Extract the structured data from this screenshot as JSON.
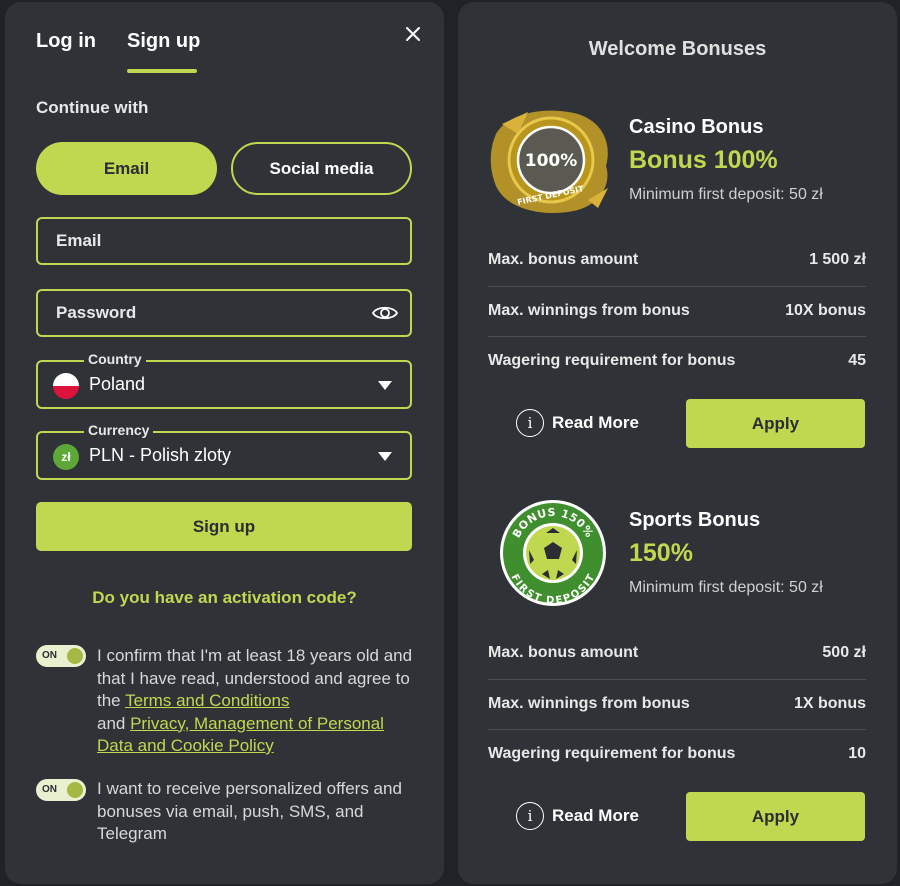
{
  "auth": {
    "tabs": [
      {
        "label": "Log in"
      },
      {
        "label": "Sign up"
      }
    ],
    "continue_with": "Continue with",
    "methods": {
      "email": "Email",
      "social": "Social media"
    },
    "email_placeholder": "Email",
    "password_placeholder": "Password",
    "country": {
      "label": "Country",
      "value": "Poland"
    },
    "currency": {
      "label": "Currency",
      "value": "PLN - Polish zloty",
      "symbol": "zł"
    },
    "signup_button": "Sign up",
    "activation_link": "Do you have an activation code?",
    "toggle_label": "ON",
    "consent1": {
      "text1": "I confirm that I'm at least 18 years old and that I have read, understood and agree to the ",
      "link1": "Terms and Conditions",
      "text2": " and ",
      "link2": "Privacy, Management of Personal Data and Cookie Policy"
    },
    "consent2": "I want to receive personalized offers and bonuses via email, push, SMS, and Telegram"
  },
  "bonuses": {
    "title": "Welcome Bonuses",
    "casino": {
      "badge_percent": "100%",
      "badge_caption": "FIRST DEPOSIT",
      "title": "Casino Bonus",
      "amount": "Bonus 100%",
      "min_deposit": "Minimum first deposit: 50 zł",
      "rows": [
        {
          "label": "Max. bonus amount",
          "value": "1 500 zł"
        },
        {
          "label": "Max. winnings from bonus",
          "value": "10X bonus"
        },
        {
          "label": "Wagering requirement for bonus",
          "value": "45"
        }
      ],
      "read_more": "Read More",
      "apply": "Apply"
    },
    "sports": {
      "badge_top": "BONUS 150%",
      "badge_bottom": "FIRST DEPOSIT",
      "title": "Sports Bonus",
      "amount": "150%",
      "min_deposit": "Minimum first deposit: 50 zł",
      "rows": [
        {
          "label": "Max. bonus amount",
          "value": "500 zł"
        },
        {
          "label": "Max. winnings from bonus",
          "value": "1X bonus"
        },
        {
          "label": "Wagering requirement for bonus",
          "value": "10"
        }
      ],
      "read_more": "Read More",
      "apply": "Apply"
    }
  },
  "colors": {
    "accent": "#c0d850",
    "panel": "#2f3236",
    "background": "#1f2226"
  },
  "icons": [
    "close-icon",
    "eye-icon",
    "poland-flag-icon",
    "zloty-currency-icon",
    "chevron-down-icon",
    "info-icon",
    "soccer-ball-icon"
  ]
}
